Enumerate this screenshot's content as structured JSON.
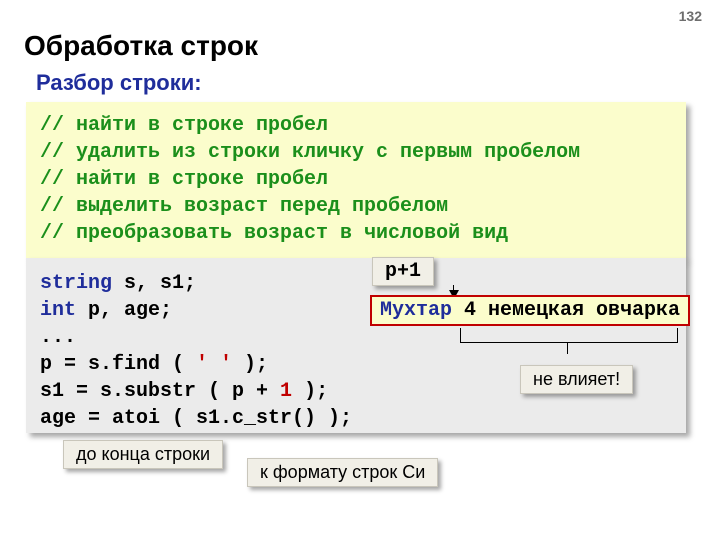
{
  "pagenum": "132",
  "title": "Обработка строк",
  "subtitle": "Разбор строки:",
  "comments_block": "// найти в строке пробел\n// удалить из строки кличку с первым пробелом\n// найти в строке пробел\n// выделить возраст перед пробелом\n// преобразовать возраст в числовой вид",
  "code": {
    "line1_kw": "string",
    "line1_rest": " s, s1;",
    "line2_kw": "int",
    "line2_rest": " p, age;",
    "line3": "...",
    "line4_a": "p = s.find ( ",
    "line4_lit": "' '",
    "line4_b": " );",
    "line5_a": "s1 = s.substr ( p + ",
    "line5_num": "1",
    "line5_b": " );",
    "line6": "age = atoi ( s1.c_str() );"
  },
  "labels": {
    "pplus1": "p+1",
    "str_part1": "Мухтар",
    "str_part2": "4 немецкая овчарка",
    "ne_vliyaet": "не влияет!",
    "do_kontsa": "до конца строки",
    "k_formatu": "к формату строк Си"
  }
}
